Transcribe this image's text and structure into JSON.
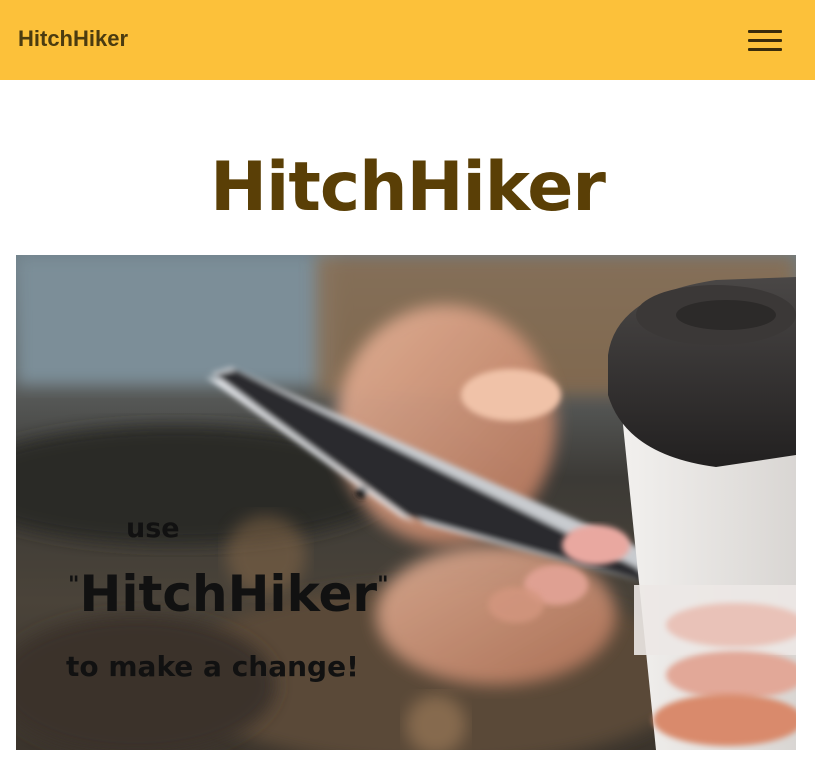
{
  "navbar": {
    "brand": "HitchHiker",
    "menu_icon": "hamburger-menu-icon"
  },
  "main": {
    "title": "HitchHiker"
  },
  "hero": {
    "line1": "use",
    "quote_open": "\"",
    "name": "HitchHiker",
    "quote_close": "\"",
    "line3": "to make a change!"
  },
  "colors": {
    "navbar_bg": "#fcc13a",
    "brand_text": "#4b3b10",
    "title_text": "#5a3f06"
  }
}
